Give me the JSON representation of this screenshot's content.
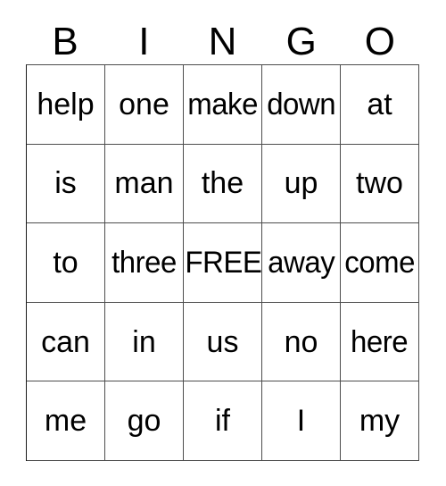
{
  "card": {
    "title": "BINGO",
    "header_letters": [
      "B",
      "I",
      "N",
      "G",
      "O"
    ],
    "free_space_label": "FREE",
    "colors": {
      "background": "#ffffff",
      "text": "#000000",
      "grid_line": "#4d4d4d"
    },
    "grid": {
      "columns": 5,
      "rows": 5,
      "cells": [
        [
          {
            "text": "help",
            "free": false
          },
          {
            "text": "one",
            "free": false
          },
          {
            "text": "make",
            "free": false
          },
          {
            "text": "down",
            "free": false
          },
          {
            "text": "at",
            "free": false
          }
        ],
        [
          {
            "text": "is",
            "free": false
          },
          {
            "text": "man",
            "free": false
          },
          {
            "text": "the",
            "free": false
          },
          {
            "text": "up",
            "free": false
          },
          {
            "text": "two",
            "free": false
          }
        ],
        [
          {
            "text": "to",
            "free": false
          },
          {
            "text": "three",
            "free": false
          },
          {
            "text": "FREE",
            "free": true
          },
          {
            "text": "away",
            "free": false
          },
          {
            "text": "come",
            "free": false
          }
        ],
        [
          {
            "text": "can",
            "free": false
          },
          {
            "text": "in",
            "free": false
          },
          {
            "text": "us",
            "free": false
          },
          {
            "text": "no",
            "free": false
          },
          {
            "text": "here",
            "free": false
          }
        ],
        [
          {
            "text": "me",
            "free": false
          },
          {
            "text": "go",
            "free": false
          },
          {
            "text": "if",
            "free": false
          },
          {
            "text": "I",
            "free": false
          },
          {
            "text": "my",
            "free": false
          }
        ]
      ]
    }
  }
}
